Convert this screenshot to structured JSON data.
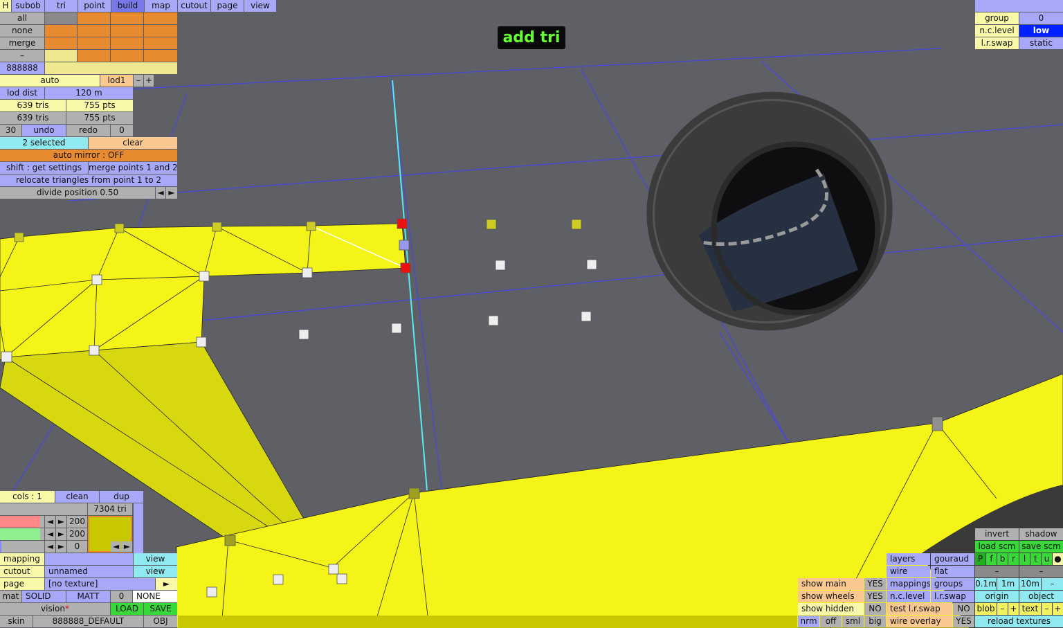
{
  "status_badge": "add tri",
  "top_menu": {
    "h": "H",
    "tabs": [
      "subob",
      "tri",
      "point",
      "build",
      "map",
      "cutout",
      "page",
      "view"
    ],
    "active_tab": "build"
  },
  "select_panel": {
    "buttons": [
      "all",
      "none",
      "merge",
      "–"
    ],
    "color_code": "888888"
  },
  "lod_panel": {
    "auto": "auto",
    "lod": "lod1",
    "minus": "–",
    "plus": "+",
    "lod_dist_label": "lod dist",
    "lod_dist_value": "120 m",
    "tris_1": "639 tris",
    "pts_1": "755 pts",
    "tris_2": "639 tris",
    "pts_2": "755 pts",
    "undo_count": "30",
    "undo": "undo",
    "redo": "redo",
    "redo_count": "0"
  },
  "selection_panel": {
    "selected": "2 selected",
    "clear": "clear",
    "auto_mirror": "auto mirror : OFF",
    "shift_settings": "shift : get settings",
    "merge_points": "merge points 1 and 2",
    "relocate": "relocate triangles from point 1 to 2",
    "divide": "divide position 0.50",
    "arrow_left": "◄",
    "arrow_right": "►"
  },
  "top_right": {
    "group_label": "group",
    "group_value": "0",
    "nc_level_label": "n.c.level",
    "nc_level_value": "low",
    "lr_swap_label": "l.r.swap",
    "lr_swap_value": "static"
  },
  "colour_panel": {
    "cols": "cols : 1",
    "clean": "clean",
    "dup": "dup",
    "tri_count": "7304 tri",
    "values": [
      "200",
      "200",
      "0"
    ],
    "swatch_color": "#c8c800",
    "arrow_left": "◄",
    "arrow_right": "►"
  },
  "material_panel": {
    "mapping": "mapping",
    "view1": "view",
    "cutout": "cutout",
    "cutout_value": "unnamed",
    "view2": "view",
    "page": "page",
    "page_value": "[no texture]",
    "page_arrow": "►",
    "mat": "mat",
    "solid": "SOLID",
    "matt": "MATT",
    "mat_num": "0",
    "none": "NONE",
    "vision": "vision",
    "vision_star": "*",
    "load": "LOAD",
    "save": "SAVE",
    "skin": "skin",
    "skin_value": "888888_DEFAULT",
    "obj": "OBJ"
  },
  "view_panel": {
    "show_main": "show main",
    "show_main_value": "YES",
    "show_wheels": "show wheels",
    "show_wheels_value": "YES",
    "show_hidden": "show hidden",
    "show_hidden_value": "NO",
    "nrm": "nrm",
    "off": "off",
    "sml": "sml",
    "big": "big",
    "layers": "layers",
    "gouraud": "gouraud",
    "wire": "wire",
    "flat": "flat",
    "mappings": "mappings",
    "groups": "groups",
    "nc_level": "n.c.level",
    "lr_swap": "l.r.swap",
    "test_lr_swap": "test l.r.swap",
    "test_lr_swap_value": "NO",
    "wire_overlay": "wire overlay",
    "wire_overlay_value": "YES",
    "invert": "invert",
    "shadow": "shadow",
    "load_scm": "load scm",
    "save_scm": "save scm",
    "letters": [
      "P",
      "f",
      "b",
      "r",
      "l",
      "t",
      "u"
    ],
    "dot": "●",
    "dash1": "–",
    "dash2": "–",
    "step_01": "0.1m",
    "step_1": "1m",
    "step_10": "10m",
    "step_minus": "–",
    "origin": "origin",
    "object": "object",
    "blob": "blob",
    "blob_minus": "–",
    "blob_plus": "+",
    "text": "text",
    "text_minus": "–",
    "text_plus": "+",
    "reload_textures": "reload textures"
  }
}
